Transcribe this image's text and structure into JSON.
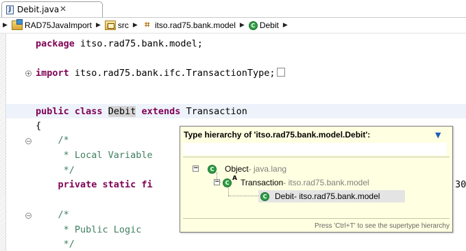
{
  "editor_tab": {
    "title": "Debit.java",
    "close_icon": "close-icon"
  },
  "breadcrumb": [
    {
      "label": "RAD75JavaImport",
      "icon": "java-project-icon"
    },
    {
      "label": "src",
      "icon": "source-folder-icon"
    },
    {
      "label": "itso.rad75.bank.model",
      "icon": "package-icon"
    },
    {
      "label": "Debit",
      "icon": "class-icon"
    }
  ],
  "code": {
    "package_kw": "package",
    "package_rest": " itso.rad75.bank.model;",
    "import_kw": "import",
    "import_rest": " itso.rad75.bank.ifc.TransactionType;",
    "class_pub": "public",
    "class_cls": " class ",
    "class_name": "Debit",
    "class_ext": " extends",
    "class_parent": " Transaction",
    "brace": "{",
    "cm1_open": "    /*",
    "cm1_body": "     * Local Variable",
    "cm1_close": "     */",
    "private_line": "    private static fi",
    "cm2_open": "    /*",
    "cm2_body": "     * Public Logic",
    "cm2_close": "     */",
    "behind_popup_text": "30"
  },
  "hierarchy_popup": {
    "title": "Type hierarchy of 'itso.rad75.bank.model.Debit':",
    "filter_value": "",
    "items": [
      {
        "name": "Object",
        "package": " - java.lang"
      },
      {
        "name": "Transaction",
        "package": " - itso.rad75.bank.model",
        "badge": "A"
      },
      {
        "name": "Debit",
        "package": " - itso.rad75.bank.model"
      }
    ],
    "footer": "Press 'Ctrl+T' to see the supertype hierarchy"
  }
}
